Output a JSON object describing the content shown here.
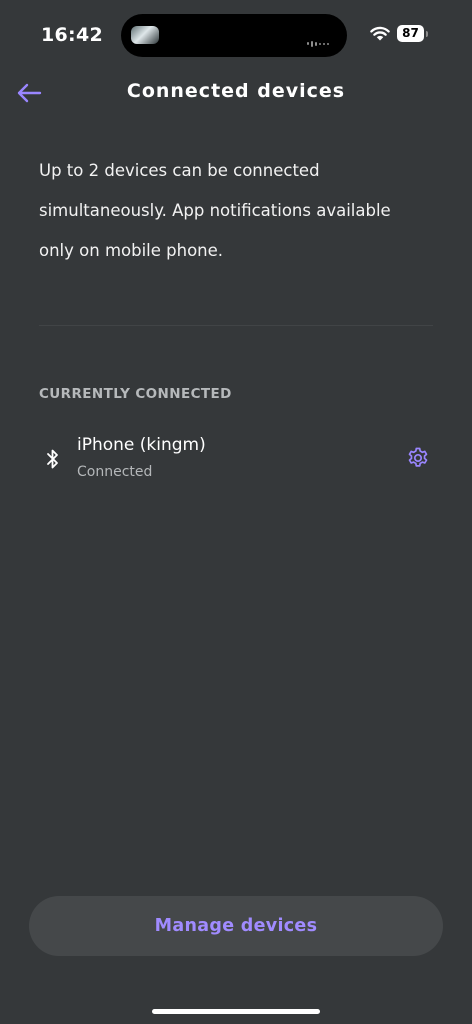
{
  "status_bar": {
    "time": "16:42",
    "battery": "87",
    "wifi_icon": "wifi-icon"
  },
  "header": {
    "title": "Connected devices",
    "back_icon": "arrow-left-icon"
  },
  "description": {
    "line1": "Up to 2 devices can be connected",
    "line2": "simultaneously. App notifications available",
    "line3": "only on mobile phone."
  },
  "section": {
    "label": "CURRENTLY CONNECTED"
  },
  "devices": [
    {
      "name": "iPhone (kingm)",
      "status": "Connected",
      "icon": "bluetooth-icon",
      "settings_icon": "gear-icon"
    }
  ],
  "footer": {
    "manage_label": "Manage devices"
  },
  "colors": {
    "background": "#35383a",
    "accent": "#9a86ff",
    "button_bg": "#45484a"
  }
}
